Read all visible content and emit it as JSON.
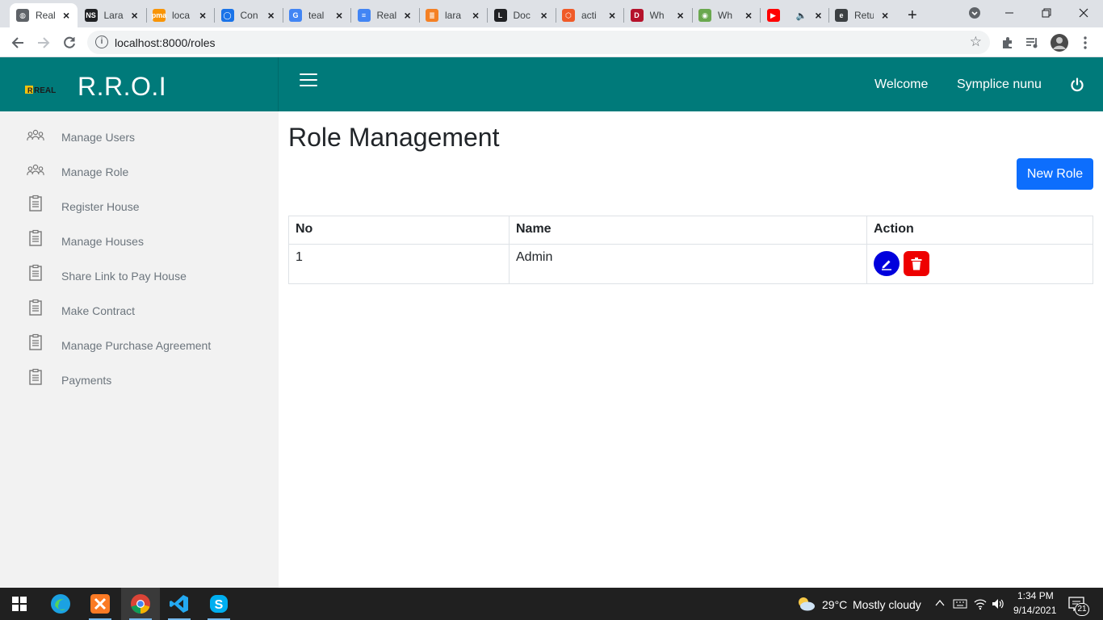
{
  "browser": {
    "tabs": [
      {
        "title": "Real",
        "fav": "globe-icon",
        "color": "#5f6368",
        "active": true
      },
      {
        "title": "Lara",
        "fav": "ns-icon",
        "color": "#202124"
      },
      {
        "title": "loca",
        "fav": "phpmyadmin-icon",
        "color": "#f89406"
      },
      {
        "title": "Con",
        "fav": "circle-icon",
        "color": "#1a73e8"
      },
      {
        "title": "teal",
        "fav": "google-icon",
        "color": "#4285f4"
      },
      {
        "title": "Real",
        "fav": "docs-icon",
        "color": "#4285f4"
      },
      {
        "title": "lara",
        "fav": "stackoverflow-icon",
        "color": "#f48024"
      },
      {
        "title": "Doc",
        "fav": "laravel-icon",
        "color": "#202124"
      },
      {
        "title": "acti",
        "fav": "hexagon-icon",
        "color": "#f05a28"
      },
      {
        "title": "Wh",
        "fav": "d-icon",
        "color": "#b5122b"
      },
      {
        "title": "Wh",
        "fav": "ring-icon",
        "color": "#6aa84f"
      },
      {
        "title": "",
        "fav": "youtube-icon",
        "color": "#ff0000"
      },
      {
        "title": "Retu",
        "fav": "edge-tab-icon",
        "color": "#3c4043"
      }
    ],
    "new_tab": "+",
    "url": "localhost:8000/roles"
  },
  "app": {
    "brand": "R.R.O.I",
    "logo_text": "REAL",
    "header": {
      "welcome": "Welcome",
      "user": "Symplice nunu"
    },
    "sidebar": [
      {
        "label": "Manage Users",
        "icon": "users-icon"
      },
      {
        "label": "Manage Role",
        "icon": "users-icon"
      },
      {
        "label": "Register House",
        "icon": "clipboard-icon"
      },
      {
        "label": "Manage Houses",
        "icon": "clipboard-icon"
      },
      {
        "label": "Share Link to Pay House",
        "icon": "clipboard-icon"
      },
      {
        "label": "Make Contract",
        "icon": "clipboard-icon"
      },
      {
        "label": "Manage Purchase Agreement",
        "icon": "clipboard-icon"
      },
      {
        "label": "Payments",
        "icon": "clipboard-icon"
      }
    ],
    "page_title": "Role Management",
    "new_role_label": "New Role",
    "table": {
      "headers": [
        "No",
        "Name",
        "Action"
      ],
      "rows": [
        {
          "no": "1",
          "name": "Admin"
        }
      ]
    },
    "colors": {
      "header": "#007a7a",
      "sidebar": "#f2f2f2",
      "primary": "#0d6efd",
      "edit": "#0000dd",
      "delete": "#ee0000"
    }
  },
  "taskbar": {
    "weather_temp": "29°C",
    "weather_desc": "Mostly cloudy",
    "time": "1:34 PM",
    "date": "9/14/2021",
    "notifications": "21"
  }
}
